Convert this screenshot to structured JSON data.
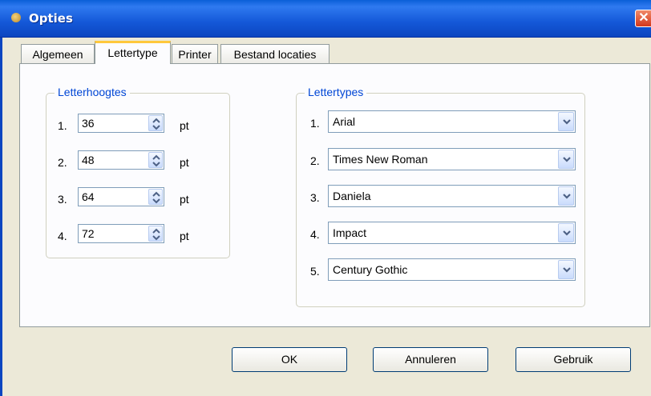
{
  "window": {
    "title": "Opties",
    "close_label": "✕"
  },
  "tabs": [
    {
      "label": "Algemeen"
    },
    {
      "label": "Lettertype"
    },
    {
      "label": "Printer"
    },
    {
      "label": "Bestand locaties"
    }
  ],
  "active_tab": "Lettertype",
  "font_sizes": {
    "legend": "Letterhoogtes",
    "unit": "pt",
    "items": [
      {
        "index": "1.",
        "value": "36"
      },
      {
        "index": "2.",
        "value": "48"
      },
      {
        "index": "3.",
        "value": "64"
      },
      {
        "index": "4.",
        "value": "72"
      }
    ]
  },
  "fonts": {
    "legend": "Lettertypes",
    "items": [
      {
        "index": "1.",
        "value": "Arial"
      },
      {
        "index": "2.",
        "value": "Times New Roman"
      },
      {
        "index": "3.",
        "value": "Daniela"
      },
      {
        "index": "4.",
        "value": "Impact"
      },
      {
        "index": "5.",
        "value": "Century Gothic"
      }
    ]
  },
  "buttons": {
    "ok": "OK",
    "cancel": "Annuleren",
    "apply": "Gebruik"
  },
  "colors": {
    "titlebar": "#1458D8",
    "legend": "#0046D5",
    "active_tab_accent": "#FFC83C",
    "close": "#D4381B"
  }
}
